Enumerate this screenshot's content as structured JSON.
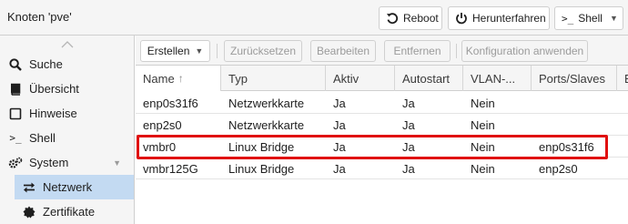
{
  "header": {
    "title": "Knoten 'pve'",
    "buttons": {
      "reboot": "Reboot",
      "shutdown": "Herunterfahren",
      "shell": "Shell"
    }
  },
  "sidebar": {
    "items": [
      {
        "label": "Suche",
        "icon": "search-icon"
      },
      {
        "label": "Übersicht",
        "icon": "book-icon"
      },
      {
        "label": "Hinweise",
        "icon": "notes-icon"
      },
      {
        "label": "Shell",
        "icon": "terminal-icon"
      },
      {
        "label": "System",
        "icon": "cogs-icon"
      },
      {
        "label": "Netzwerk",
        "icon": "exchange-icon"
      },
      {
        "label": "Zertifikate",
        "icon": "certificate-icon"
      }
    ]
  },
  "toolbar": {
    "create": "Erstellen",
    "revert": "Zurücksetzen",
    "edit": "Bearbeiten",
    "remove": "Entfernen",
    "apply": "Konfiguration anwenden"
  },
  "grid": {
    "columns": [
      "Name",
      "Typ",
      "Aktiv",
      "Autostart",
      "VLAN-...",
      "Ports/Slaves",
      "B"
    ],
    "sort_indicator": "↑",
    "rows": [
      {
        "name": "enp0s31f6",
        "type": "Netzwerkkarte",
        "active": "Ja",
        "autostart": "Ja",
        "vlan": "Nein",
        "ports": ""
      },
      {
        "name": "enp2s0",
        "type": "Netzwerkkarte",
        "active": "Ja",
        "autostart": "Ja",
        "vlan": "Nein",
        "ports": ""
      },
      {
        "name": "vmbr0",
        "type": "Linux Bridge",
        "active": "Ja",
        "autostart": "Ja",
        "vlan": "Nein",
        "ports": "enp0s31f6"
      },
      {
        "name": "vmbr125G",
        "type": "Linux Bridge",
        "active": "Ja",
        "autostart": "Ja",
        "vlan": "Nein",
        "ports": "enp2s0"
      }
    ]
  },
  "colors": {
    "highlight": "#e01010",
    "selected_nav": "#c3daf2"
  }
}
